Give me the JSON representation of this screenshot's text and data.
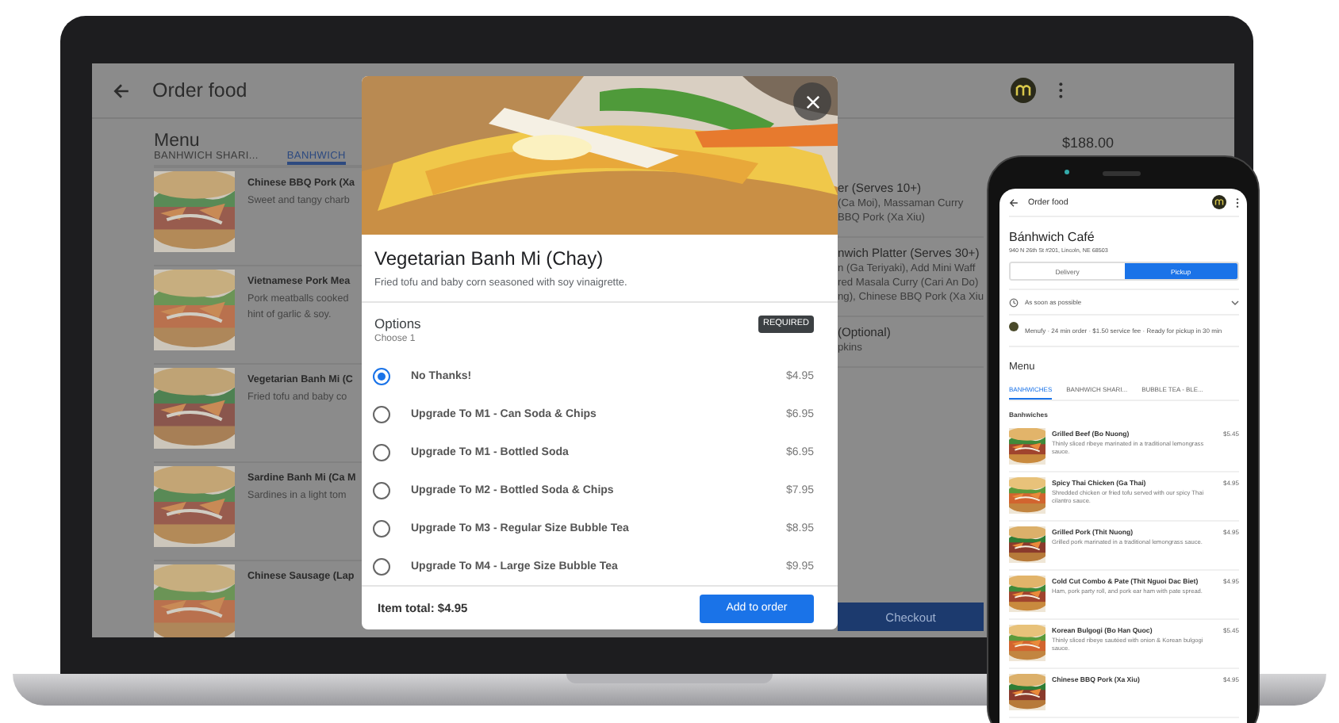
{
  "laptop": {
    "title": "Order food",
    "menu_title": "Menu",
    "total": "$188.00",
    "tabs": [
      {
        "label": "BANHWICH SHARI...",
        "selected": false
      },
      {
        "label": "BANHWICH",
        "selected": true
      }
    ],
    "items": [
      {
        "name": "Chinese BBQ Pork (Xa",
        "description_lines": [
          "Sweet and tangy charb"
        ]
      },
      {
        "name": "Vietnamese Pork Mea",
        "description_lines": [
          "Pork meatballs cooked",
          "hint of garlic & soy."
        ]
      },
      {
        "name": "Vegetarian Banh Mi (C",
        "description_lines": [
          "Fried tofu and baby co"
        ]
      },
      {
        "name": "Sardine Banh Mi (Ca M",
        "description_lines": [
          "Sardines in a light tom"
        ]
      },
      {
        "name": "Chinese Sausage (Lap"
      }
    ],
    "right_sections": [
      {
        "title": "er (Serves 10+)",
        "lines": [
          "(Ca Moi), Massaman Curry",
          "BBQ Pork (Xa Xiu)"
        ]
      },
      {
        "title": "nwich Platter (Serves 30+)",
        "lines": [
          "n (Ga Teriyaki), Add Mini Waff",
          "red Masala Curry (Cari An Do)",
          "ng), Chinese BBQ Pork (Xa Xiu"
        ]
      },
      {
        "title": "(Optional)",
        "lines": [
          "pkins"
        ]
      }
    ],
    "checkout": "Checkout"
  },
  "modal": {
    "title": "Vegetarian Banh Mi (Chay)",
    "description": "Fried tofu and baby corn seasoned with soy vinaigrette.",
    "options_title": "Options",
    "options_hint": "Choose 1",
    "badge": "REQUIRED",
    "options": [
      {
        "label": "No Thanks!",
        "price": "$4.95",
        "selected": true
      },
      {
        "label": "Upgrade To M1 - Can Soda & Chips",
        "price": "$6.95",
        "selected": false
      },
      {
        "label": "Upgrade To M1 - Bottled Soda",
        "price": "$6.95",
        "selected": false
      },
      {
        "label": "Upgrade To M2 - Bottled Soda & Chips",
        "price": "$7.95",
        "selected": false
      },
      {
        "label": "Upgrade To M3 - Regular Size Bubble Tea",
        "price": "$8.95",
        "selected": false
      },
      {
        "label": "Upgrade To M4 - Large Size Bubble Tea",
        "price": "$9.95",
        "selected": false
      }
    ],
    "item_total": "Item total: $4.95",
    "add_button": "Add to order"
  },
  "phone": {
    "title": "Order food",
    "restaurant": "Bánhwich Café",
    "address": "940 N 26th St #201, Lincoln, NE 68503",
    "order_modes": [
      {
        "label": "Delivery",
        "selected": false
      },
      {
        "label": "Pickup",
        "selected": true
      }
    ],
    "time": "As soon as possible",
    "info": "Menufy · 24 min order · $1.50 service fee · Ready for pickup in 30 min",
    "menu_title": "Menu",
    "tabs": [
      {
        "label": "BANHWICHES",
        "selected": true
      },
      {
        "label": "BANHWICH SHARI...",
        "selected": false
      },
      {
        "label": "BUBBLE TEA - BLE...",
        "selected": false
      }
    ],
    "section": "Banhwiches",
    "items": [
      {
        "name": "Grilled Beef (Bo Nuong)",
        "description": "Thinly sliced ribeye marinated in a traditional lemongrass sauce.",
        "price": "$5.45"
      },
      {
        "name": "Spicy Thai Chicken (Ga Thai)",
        "description": "Shredded chicken or fried tofu served with our spicy Thai cilantro sauce.",
        "price": "$4.95"
      },
      {
        "name": "Grilled Pork (Thit Nuong)",
        "description": "Grilled pork marinated in a traditional lemongrass sauce.",
        "price": "$4.95"
      },
      {
        "name": "Cold Cut Combo & Pate (Thit Nguoi Dac Biet)",
        "description": "Ham, pork party roll, and pork ear ham with pate spread.",
        "price": "$4.95"
      },
      {
        "name": "Korean Bulgogi (Bo Han Quoc)",
        "description": "Thinly sliced ribeye sautéed with onion & Korean bulgogi sauce.",
        "price": "$5.45"
      },
      {
        "name": "Chinese BBQ Pork (Xa Xiu)",
        "price": "$4.95"
      }
    ]
  }
}
